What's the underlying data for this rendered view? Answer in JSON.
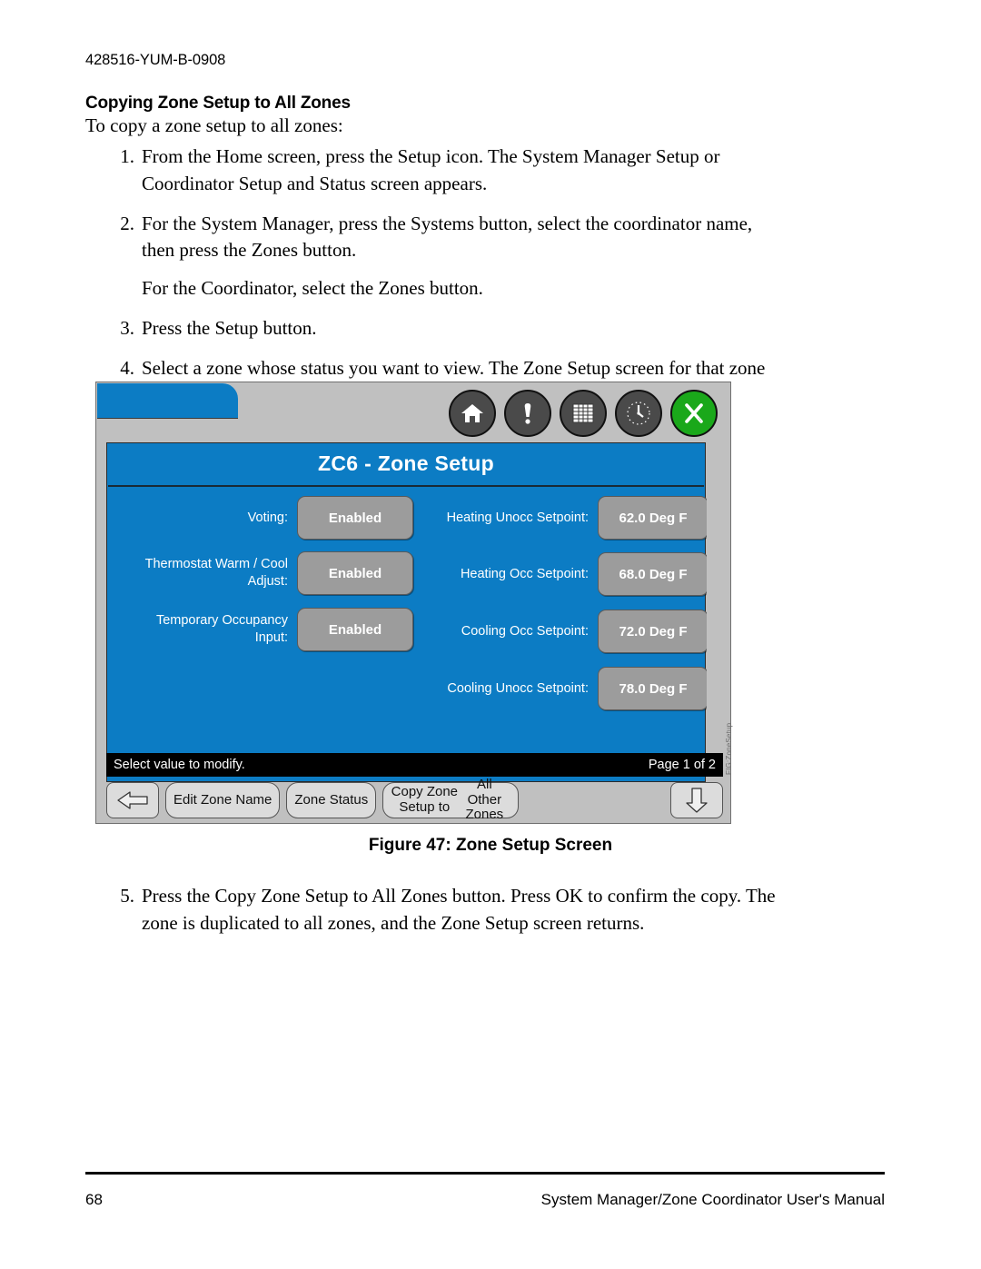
{
  "document": {
    "doc_id": "428516-YUM-B-0908",
    "section_title": "Copying Zone Setup to All Zones",
    "intro": "To copy a zone setup to all zones:",
    "steps": [
      {
        "num": "1.",
        "text": "From the Home screen, press the Setup icon. The System Manager Setup or Coordinator Setup and Status screen appears."
      },
      {
        "num": "2.",
        "text": "For the System Manager, press the Systems button, select the coordinator name, then press the Zones button.",
        "sub": "For the Coordinator, select the Zones button."
      },
      {
        "num": "3.",
        "text": "Press the Setup button."
      },
      {
        "num": "4.",
        "text": "Select a zone whose status you want to view. The Zone Setup screen for that zone appears."
      }
    ],
    "step5": {
      "num": "5.",
      "text": "Press the Copy Zone Setup to All Zones button. Press OK to confirm the copy. The zone is duplicated to all zones, and the Zone Setup screen returns."
    },
    "figure_caption": "Figure 47: Zone Setup Screen",
    "figure_code": "FIG:ZoneSetup",
    "footer": {
      "page_number": "68",
      "manual_title": "System Manager/Zone Coordinator User's Manual"
    }
  },
  "device_screen": {
    "title": "ZC6 - Zone Setup",
    "toolbar_icons": [
      {
        "name": "home-icon",
        "color": "#4a4a4a"
      },
      {
        "name": "alarm-icon",
        "color": "#4a4a4a"
      },
      {
        "name": "schedule-icon",
        "color": "#4a4a4a"
      },
      {
        "name": "clock-icon",
        "color": "#4a4a4a"
      },
      {
        "name": "setup-tools-icon",
        "color": "#1aa81a"
      }
    ],
    "left_fields": [
      {
        "label": "Voting:",
        "value": "Enabled"
      },
      {
        "label": "Thermostat Warm / Cool Adjust:",
        "value": "Enabled"
      },
      {
        "label": "Temporary Occupancy Input:",
        "value": "Enabled"
      }
    ],
    "right_fields": [
      {
        "label": "Heating Unocc Setpoint:",
        "value": "62.0 Deg F"
      },
      {
        "label": "Heating Occ Setpoint:",
        "value": "68.0 Deg F"
      },
      {
        "label": "Cooling Occ Setpoint:",
        "value": "72.0 Deg F"
      },
      {
        "label": "Cooling Unocc Setpoint:",
        "value": "78.0 Deg F"
      }
    ],
    "status_message": "Select value to modify.",
    "page_indicator": "Page 1 of 2",
    "buttons": {
      "back": "",
      "edit_zone_name": "Edit Zone Name",
      "zone_status": "Zone Status",
      "copy_zone_line1": "Copy Zone Setup to",
      "copy_zone_line2": "All Other Zones",
      "page_down": ""
    },
    "colors": {
      "screen_blue": "#0c7cc4",
      "bezel_gray": "#c0c0c0",
      "value_gray": "#9c9c9c",
      "accent_green": "#1aa81a"
    }
  }
}
